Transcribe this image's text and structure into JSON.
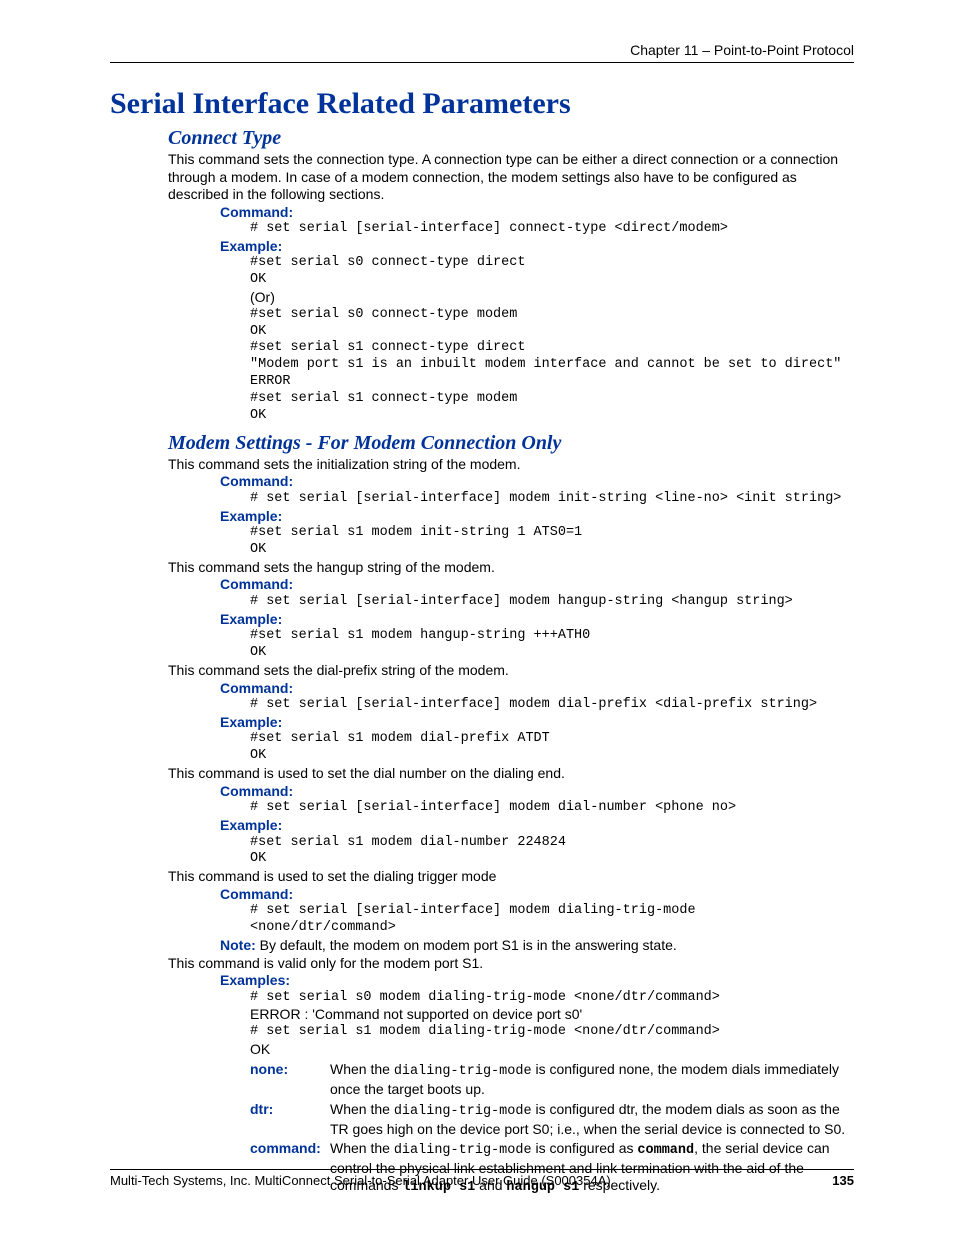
{
  "header": "Chapter 11 – Point-to-Point Protocol",
  "title": "Serial Interface Related Parameters",
  "connect": {
    "heading": "Connect Type",
    "intro": "This command sets the connection type. A connection type can be either a direct connection or a connection through a modem. In case of a modem connection, the modem settings also have to be configured as described in the following sections.",
    "command_label": "Command:",
    "command": "# set serial [serial-interface] connect-type <direct/modem>",
    "example_label": "Example:",
    "ex1": "#set serial s0 connect-type direct",
    "ok": "OK",
    "or": "(Or)",
    "ex2": "#set serial s0 connect-type modem",
    "ex3": "#set serial s1 connect-type direct",
    "err": "\"Modem port s1 is an inbuilt modem interface and cannot be set to direct\"",
    "error": "ERROR",
    "ex4": "#set serial s1 connect-type modem"
  },
  "modem": {
    "heading": "Modem Settings - For Modem Connection Only",
    "p1": "This command sets the initialization string of the modem.",
    "cmd_label": "Command:",
    "ex_label": "Example:",
    "c1": "# set serial [serial-interface] modem init-string <line-no> <init string>",
    "e1": "#set serial s1 modem init-string 1 ATS0=1",
    "ok": "OK",
    "p2": "This command sets the hangup string of the modem.",
    "c2": "# set serial [serial-interface] modem hangup-string <hangup string>",
    "e2": "#set serial s1 modem hangup-string +++ATH0",
    "p3": "This command sets the dial-prefix string of the modem.",
    "c3": "# set serial [serial-interface] modem dial-prefix <dial-prefix string>",
    "e3": "#set serial s1 modem dial-prefix ATDT",
    "p4": "This command is used to set the dial number on the dialing end.",
    "c4": "# set serial [serial-interface] modem dial-number <phone no>",
    "e4": "#set serial s1 modem dial-number 224824",
    "p5": "This command is used to set the dialing trigger mode",
    "c5a": "# set serial [serial-interface] modem dialing-trig-mode",
    "c5b": "<none/dtr/command>",
    "note_label": "Note:",
    "note_text": "  By default, the modem on modem port S1 is in the answering state.",
    "p6": "This command is valid only for the modem port S1.",
    "examples_label": "Examples:",
    "ex_s0": "# set serial s0 modem dialing-trig-mode <none/dtr/command>",
    "ex_s0_err": "ERROR : 'Command not supported on device port s0'",
    "ex_s1": "# set serial s1 modem dialing-trig-mode <none/dtr/command>",
    "defs": {
      "none": {
        "k": "none:",
        "pre": "When the ",
        "mode": "dialing-trig-mode",
        "post": " is configured none, the modem dials immediately once the target boots up."
      },
      "dtr": {
        "k": "dtr:",
        "pre": "When the ",
        "mode": "dialing-trig-mode",
        "post": " is configured dtr, the modem dials as soon as the TR goes high on the device port S0; i.e., when the serial device is connected to S0."
      },
      "cmd": {
        "k": "command:",
        "pre": "When the ",
        "mode": "dialing-trig-mode",
        "post1": " is configured as ",
        "kw": "command",
        "post2": ", the serial device can control the physical link establishment and link termination with the aid of the commands ",
        "linkup": "linkup s1",
        "and": " and ",
        "hangup": "hangup s1",
        "post3": " respectively."
      }
    }
  },
  "footer": {
    "text": "Multi-Tech Systems, Inc. MultiConnect Serial-to-Serial Adapter User Guide (S000354A)",
    "page": "135"
  }
}
